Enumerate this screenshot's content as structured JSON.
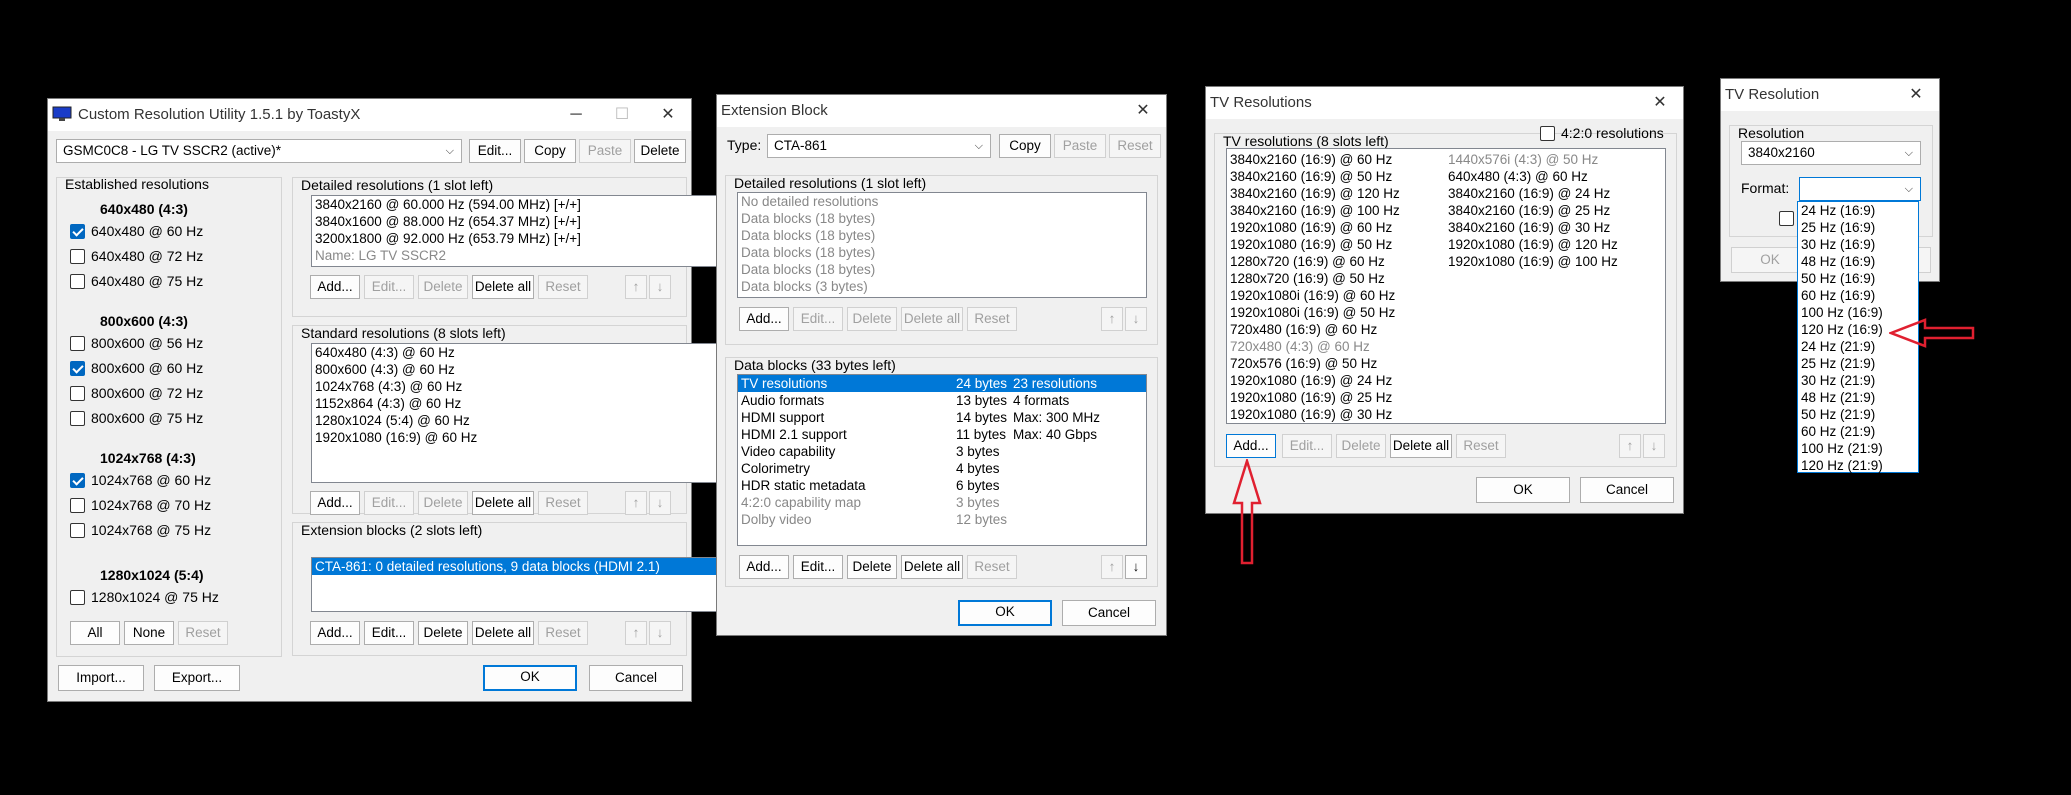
{
  "w1": {
    "title": "Custom Resolution Utility 1.5.1 by ToastyX",
    "monitor": "GSMC0C8 - LG TV SSCR2 (active)*",
    "btn_edit": "Edit...",
    "btn_copy": "Copy",
    "btn_paste": "Paste",
    "btn_delete": "Delete",
    "established": {
      "label": "Established resolutions",
      "g1": "640x480 (4:3)",
      "c1a": "640x480 @ 60 Hz",
      "c1b": "640x480 @ 72 Hz",
      "c1c": "640x480 @ 75 Hz",
      "g2": "800x600 (4:3)",
      "c2a": "800x600 @ 56 Hz",
      "c2b": "800x600 @ 60 Hz",
      "c2c": "800x600 @ 72 Hz",
      "c2d": "800x600 @ 75 Hz",
      "g3": "1024x768 (4:3)",
      "c3a": "1024x768 @ 60 Hz",
      "c3b": "1024x768 @ 70 Hz",
      "c3c": "1024x768 @ 75 Hz",
      "g4": "1280x1024 (5:4)",
      "c4a": "1280x1024 @ 75 Hz",
      "all": "All",
      "none": "None",
      "reset": "Reset"
    },
    "detailed": {
      "label": "Detailed resolutions (1 slot left)",
      "items": [
        "3840x2160 @ 60.000 Hz (594.00 MHz) [+/+]",
        "3840x1600 @ 88.000 Hz (654.37 MHz) [+/+]",
        "3200x1800 @ 92.000 Hz (653.79 MHz) [+/+]",
        "Name: LG TV SSCR2"
      ]
    },
    "standard": {
      "label": "Standard resolutions (8 slots left)",
      "items": [
        "640x480 (4:3) @ 60 Hz",
        "800x600 (4:3) @ 60 Hz",
        "1024x768 (4:3) @ 60 Hz",
        "1152x864 (4:3) @ 60 Hz",
        "1280x1024 (5:4) @ 60 Hz",
        "1920x1080 (16:9) @ 60 Hz"
      ]
    },
    "extension": {
      "label": "Extension blocks (2 slots left)",
      "items": [
        "CTA-861: 0 detailed resolutions, 9 data blocks (HDMI 2.1)"
      ]
    },
    "add": "Add...",
    "edit": "Edit...",
    "delete": "Delete",
    "delete_all": "Delete all",
    "reset": "Reset",
    "up": "↑",
    "down": "↓",
    "import": "Import...",
    "export": "Export...",
    "ok": "OK",
    "cancel": "Cancel"
  },
  "w2": {
    "title": "Extension Block",
    "type_label": "Type:",
    "type_value": "CTA-861",
    "copy": "Copy",
    "paste": "Paste",
    "reset": "Reset",
    "detailed": {
      "label": "Detailed resolutions (1 slot left)",
      "items": [
        "No detailed resolutions",
        "Data blocks (18 bytes)",
        "Data blocks (18 bytes)",
        "Data blocks (18 bytes)",
        "Data blocks (18 bytes)",
        "Data blocks (3 bytes)"
      ]
    },
    "datablocks": {
      "label": "Data blocks (33 bytes left)",
      "rows": [
        {
          "name": "TV resolutions",
          "size": "24 bytes",
          "info": "23 resolutions"
        },
        {
          "name": "Audio formats",
          "size": "13 bytes",
          "info": "4 formats"
        },
        {
          "name": "HDMI support",
          "size": "14 bytes",
          "info": "Max: 300 MHz"
        },
        {
          "name": "HDMI 2.1 support",
          "size": "11 bytes",
          "info": "Max: 40 Gbps"
        },
        {
          "name": "Video capability",
          "size": "3 bytes",
          "info": ""
        },
        {
          "name": "Colorimetry",
          "size": "4 bytes",
          "info": ""
        },
        {
          "name": "HDR static metadata",
          "size": "6 bytes",
          "info": ""
        },
        {
          "name": "4:2:0 capability map",
          "size": "3 bytes",
          "info": ""
        },
        {
          "name": "Dolby video",
          "size": "12 bytes",
          "info": ""
        }
      ]
    },
    "add": "Add...",
    "edit": "Edit...",
    "delete": "Delete",
    "delete_all": "Delete all",
    "up": "↑",
    "down": "↓",
    "ok": "OK",
    "cancel": "Cancel"
  },
  "w3": {
    "title": "TV Resolutions",
    "list_label": "TV resolutions (8 slots left)",
    "ycbcr": "4:2:0 resolutions",
    "col1": [
      "3840x2160 (16:9) @ 60 Hz",
      "3840x2160 (16:9) @ 50 Hz",
      "3840x2160 (16:9) @ 120 Hz",
      "3840x2160 (16:9) @ 100 Hz",
      "1920x1080 (16:9) @ 60 Hz",
      "1920x1080 (16:9) @ 50 Hz",
      "1280x720 (16:9) @ 60 Hz",
      "1280x720 (16:9) @ 50 Hz",
      "1920x1080i (16:9) @ 60 Hz",
      "1920x1080i (16:9) @ 50 Hz",
      "720x480 (16:9) @ 60 Hz",
      "720x480 (4:3) @ 60 Hz",
      "720x576 (16:9) @ 50 Hz",
      "1920x1080 (16:9) @ 24 Hz",
      "1920x1080 (16:9) @ 25 Hz",
      "1920x1080 (16:9) @ 30 Hz"
    ],
    "col2": [
      "1440x576i (4:3) @ 50 Hz",
      "640x480 (4:3) @ 60 Hz",
      "3840x2160 (16:9) @ 24 Hz",
      "3840x2160 (16:9) @ 25 Hz",
      "3840x2160 (16:9) @ 30 Hz",
      "1920x1080 (16:9) @ 120 Hz",
      "1920x1080 (16:9) @ 100 Hz"
    ],
    "add": "Add...",
    "edit": "Edit...",
    "delete": "Delete",
    "delete_all": "Delete all",
    "reset": "Reset",
    "up": "↑",
    "down": "↓",
    "ok": "OK",
    "cancel": "Cancel"
  },
  "w4": {
    "title": "TV Resolution",
    "res_label": "Resolution",
    "res_value": "3840x2160",
    "format_label": "Format:",
    "format_value": "",
    "ok": "OK",
    "options": [
      "24 Hz (16:9)",
      "25 Hz (16:9)",
      "30 Hz (16:9)",
      "48 Hz (16:9)",
      "50 Hz (16:9)",
      "60 Hz (16:9)",
      "100 Hz (16:9)",
      "120 Hz (16:9)",
      "24 Hz (21:9)",
      "25 Hz (21:9)",
      "30 Hz (21:9)",
      "48 Hz (21:9)",
      "50 Hz (21:9)",
      "60 Hz (21:9)",
      "100 Hz (21:9)",
      "120 Hz (21:9)"
    ]
  },
  "colors": {
    "accent": "#0078d7",
    "arrow": "#e02030"
  }
}
